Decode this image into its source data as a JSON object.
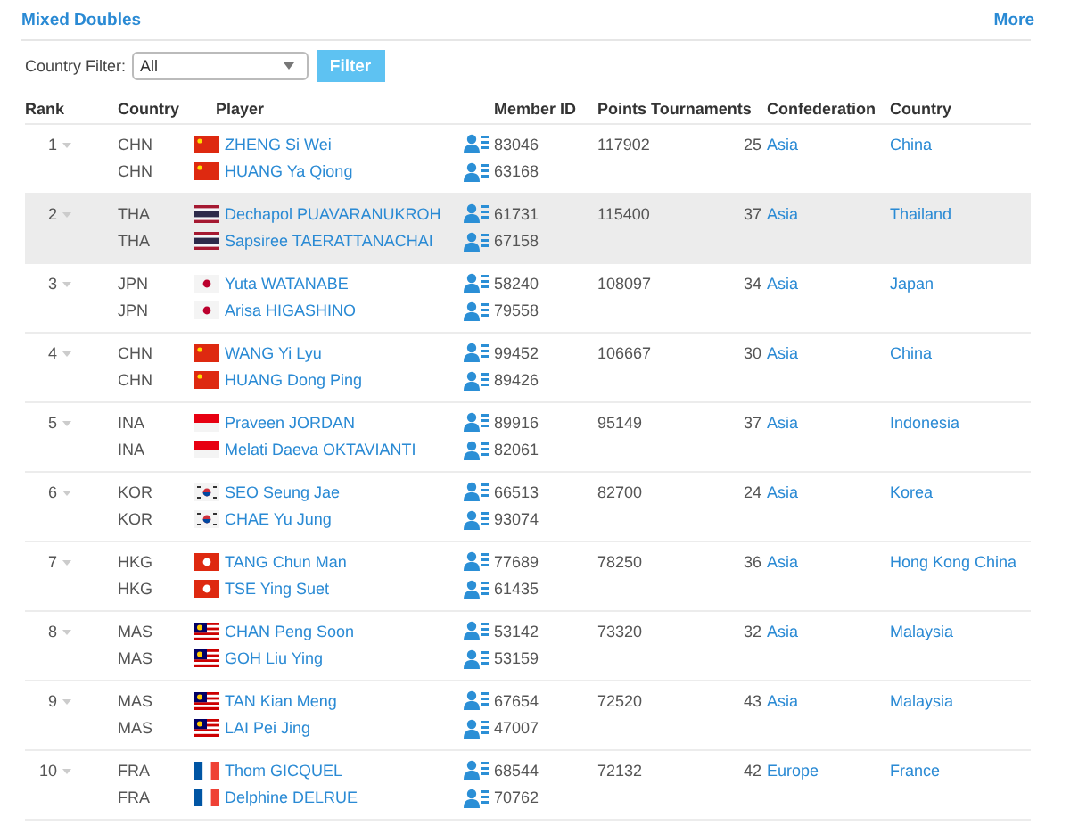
{
  "header": {
    "title": "Mixed Doubles",
    "more_link": "More"
  },
  "filter": {
    "label": "Country Filter:",
    "value": "All",
    "button": "Filter"
  },
  "table": {
    "columns": [
      "Rank",
      "Country",
      "Player",
      "Member ID",
      "Points",
      "Tournaments",
      "Confederation",
      "Country"
    ],
    "rows": [
      {
        "rank": "1",
        "highlighted": false,
        "points": "117902",
        "tournaments": "25",
        "confederation": "Asia",
        "country": "China",
        "players": [
          {
            "country_code": "CHN",
            "kind": "china",
            "name": "ZHENG Si Wei",
            "member_id": "83046"
          },
          {
            "country_code": "CHN",
            "kind": "china",
            "name": "HUANG Ya Qiong",
            "member_id": "63168"
          }
        ]
      },
      {
        "rank": "2",
        "highlighted": true,
        "points": "115400",
        "tournaments": "37",
        "confederation": "Asia",
        "country": "Thailand",
        "players": [
          {
            "country_code": "THA",
            "kind": "thailand",
            "name": "Dechapol PUAVARANUKROH",
            "member_id": "61731"
          },
          {
            "country_code": "THA",
            "kind": "thailand",
            "name": "Sapsiree TAERATTANACHAI",
            "member_id": "67158"
          }
        ]
      },
      {
        "rank": "3",
        "highlighted": false,
        "points": "108097",
        "tournaments": "34",
        "confederation": "Asia",
        "country": "Japan",
        "players": [
          {
            "country_code": "JPN",
            "kind": "japan",
            "name": "Yuta WATANABE",
            "member_id": "58240"
          },
          {
            "country_code": "JPN",
            "kind": "japan",
            "name": "Arisa HIGASHINO",
            "member_id": "79558"
          }
        ]
      },
      {
        "rank": "4",
        "highlighted": false,
        "points": "106667",
        "tournaments": "30",
        "confederation": "Asia",
        "country": "China",
        "players": [
          {
            "country_code": "CHN",
            "kind": "china",
            "name": "WANG Yi Lyu",
            "member_id": "99452"
          },
          {
            "country_code": "CHN",
            "kind": "china",
            "name": "HUANG Dong Ping",
            "member_id": "89426"
          }
        ]
      },
      {
        "rank": "5",
        "highlighted": false,
        "points": "95149",
        "tournaments": "37",
        "confederation": "Asia",
        "country": "Indonesia",
        "players": [
          {
            "country_code": "INA",
            "kind": "indonesia",
            "name": "Praveen JORDAN",
            "member_id": "89916"
          },
          {
            "country_code": "INA",
            "kind": "indonesia",
            "name": "Melati Daeva OKTAVIANTI",
            "member_id": "82061"
          }
        ]
      },
      {
        "rank": "6",
        "highlighted": false,
        "points": "82700",
        "tournaments": "24",
        "confederation": "Asia",
        "country": "Korea",
        "players": [
          {
            "country_code": "KOR",
            "kind": "korea",
            "name": "SEO Seung Jae",
            "member_id": "66513"
          },
          {
            "country_code": "KOR",
            "kind": "korea",
            "name": "CHAE Yu Jung",
            "member_id": "93074"
          }
        ]
      },
      {
        "rank": "7",
        "highlighted": false,
        "points": "78250",
        "tournaments": "36",
        "confederation": "Asia",
        "country": "Hong Kong China",
        "players": [
          {
            "country_code": "HKG",
            "kind": "hongkong",
            "name": "TANG Chun Man",
            "member_id": "77689"
          },
          {
            "country_code": "HKG",
            "kind": "hongkong",
            "name": "TSE Ying Suet",
            "member_id": "61435"
          }
        ]
      },
      {
        "rank": "8",
        "highlighted": false,
        "points": "73320",
        "tournaments": "32",
        "confederation": "Asia",
        "country": "Malaysia",
        "players": [
          {
            "country_code": "MAS",
            "kind": "malaysia",
            "name": "CHAN Peng Soon",
            "member_id": "53142"
          },
          {
            "country_code": "MAS",
            "kind": "malaysia",
            "name": "GOH Liu Ying",
            "member_id": "53159"
          }
        ]
      },
      {
        "rank": "9",
        "highlighted": false,
        "points": "72520",
        "tournaments": "43",
        "confederation": "Asia",
        "country": "Malaysia",
        "players": [
          {
            "country_code": "MAS",
            "kind": "malaysia",
            "name": "TAN Kian Meng",
            "member_id": "67654"
          },
          {
            "country_code": "MAS",
            "kind": "malaysia",
            "name": "LAI Pei Jing",
            "member_id": "47007"
          }
        ]
      },
      {
        "rank": "10",
        "highlighted": false,
        "points": "72132",
        "tournaments": "42",
        "confederation": "Europe",
        "country": "France",
        "players": [
          {
            "country_code": "FRA",
            "kind": "france",
            "name": "Thom GICQUEL",
            "member_id": "68544"
          },
          {
            "country_code": "FRA",
            "kind": "france",
            "name": "Delphine DELRUE",
            "member_id": "70762"
          }
        ]
      }
    ]
  }
}
